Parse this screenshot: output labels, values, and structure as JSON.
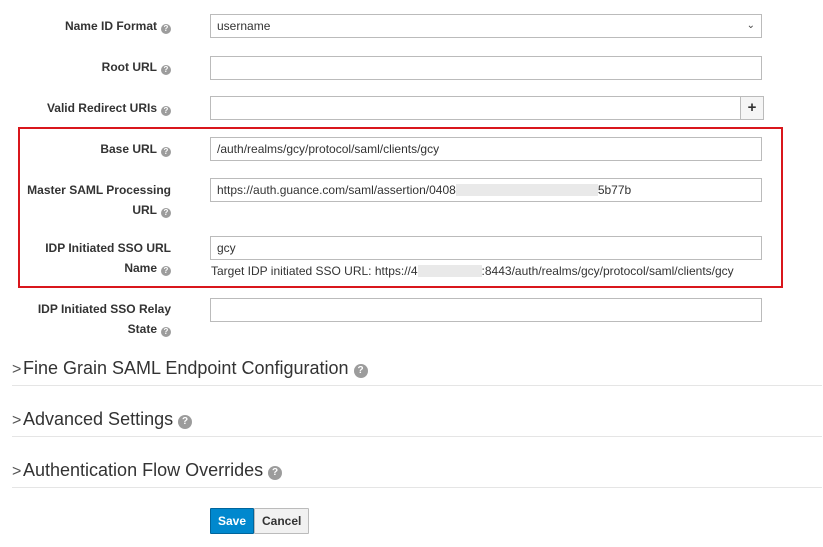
{
  "form": {
    "name_id_format": {
      "label": "Name ID Format",
      "value": "username"
    },
    "root_url": {
      "label": "Root URL",
      "value": ""
    },
    "valid_redirect_uris": {
      "label": "Valid Redirect URIs",
      "value": "",
      "add_symbol": "+"
    },
    "base_url": {
      "label": "Base URL",
      "value": "/auth/realms/gcy/protocol/saml/clients/gcy"
    },
    "master_saml_processing_url": {
      "label_line1": "Master SAML Processing",
      "label_line2": "URL",
      "value_prefix": "https://auth.guance.com/saml/assertion/0408",
      "value_suffix": "5b77b"
    },
    "idp_sso_url_name": {
      "label_line1": "IDP Initiated SSO URL",
      "label_line2": "Name",
      "value": "gcy",
      "help_prefix": "Target IDP initiated SSO URL: https://4",
      "help_suffix": ":8443/auth/realms/gcy/protocol/saml/clients/gcy"
    },
    "idp_sso_relay_state": {
      "label_line1": "IDP Initiated SSO Relay",
      "label_line2": "State",
      "value": ""
    },
    "help_icon": "?"
  },
  "sections": [
    {
      "title": "Fine Grain SAML Endpoint Configuration"
    },
    {
      "title": "Advanced Settings"
    },
    {
      "title": "Authentication Flow Overrides"
    }
  ],
  "chevron": ">",
  "buttons": {
    "save": "Save",
    "cancel": "Cancel"
  },
  "colors": {
    "highlight": "#d9161c",
    "primary": "#0088ce"
  }
}
